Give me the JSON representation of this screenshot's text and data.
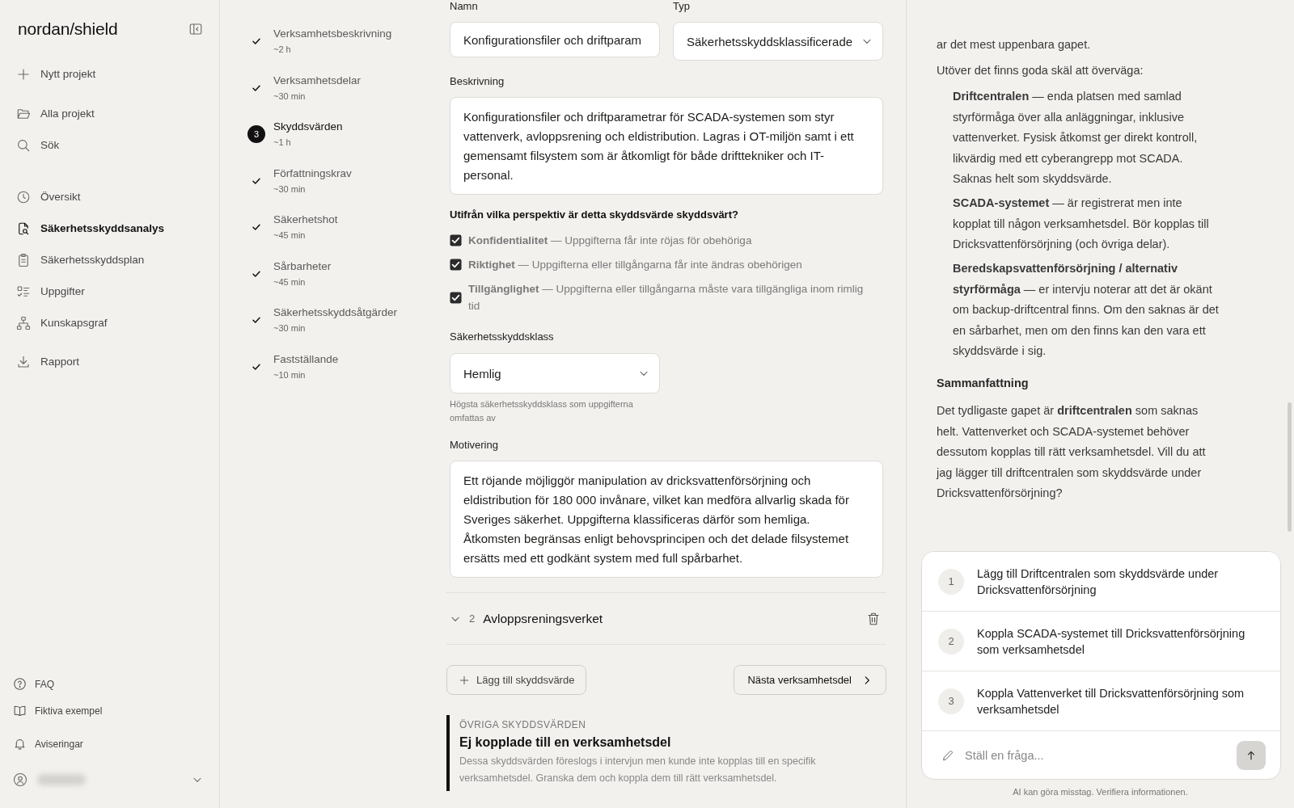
{
  "sidebar": {
    "logo": "nordan/shield",
    "groups": [
      {
        "items": [
          {
            "label": "Nytt projekt",
            "selected": false
          }
        ]
      },
      {
        "items": [
          {
            "label": "Alla projekt",
            "selected": false
          },
          {
            "label": "Sök",
            "selected": false
          }
        ]
      },
      {
        "items": [
          {
            "label": "Översikt",
            "selected": false
          },
          {
            "label": "Säkerhetsskyddsanalys",
            "selected": true
          },
          {
            "label": "Säkerhetsskyddsplan",
            "selected": false
          },
          {
            "label": "Uppgifter",
            "selected": false
          },
          {
            "label": "Kunskapsgraf",
            "selected": false
          }
        ]
      },
      {
        "items": [
          {
            "label": "Rapport",
            "selected": false
          }
        ]
      }
    ],
    "footer_items": [
      {
        "label": "FAQ"
      },
      {
        "label": "Fiktiva exempel"
      },
      {
        "label": "Aviseringar"
      }
    ]
  },
  "steps": [
    {
      "label": "Verksamhetsbeskrivning",
      "duration": "~2 h",
      "completed": true,
      "selected": false
    },
    {
      "label": "Verksamhetsdelar",
      "duration": "~30 min",
      "completed": true,
      "selected": false
    },
    {
      "label": "Skyddsvärden",
      "duration": "~1 h",
      "completed": false,
      "selected": true,
      "number": "3"
    },
    {
      "label": "Författningskrav",
      "duration": "~30 min",
      "completed": true,
      "selected": false
    },
    {
      "label": "Säkerhetshot",
      "duration": "~45 min",
      "completed": true,
      "selected": false
    },
    {
      "label": "Sårbarheter",
      "duration": "~45 min",
      "completed": true,
      "selected": false
    },
    {
      "label": "Säkerhetsskyddsåtgärder",
      "duration": "~30 min",
      "completed": true,
      "selected": false
    },
    {
      "label": "Fastställande",
      "duration": "~10 min",
      "completed": true,
      "selected": false
    }
  ],
  "protection_value": {
    "name_field": {
      "label": "Namn",
      "value": "Konfigurationsfiler och driftparam"
    },
    "type_field": {
      "label": "Typ",
      "value": "Säkerhetsskyddsklassificerade"
    },
    "description_field": {
      "label": "Beskrivning",
      "value": "Konfigurationsfiler och driftparametrar för SCADA-systemen som styr vattenverk, avloppsrening och eldistribution. Lagras i OT-miljön samt i ett gemensamt filsystem som är åtkomligt för både drifttekniker och IT-personal."
    },
    "perspectives": {
      "question": "Utifrån vilka perspektiv är detta skyddsvärde skyddsvärt?",
      "options": [
        {
          "label": "**Konfidentialitet** — Uppgifterna får inte röjas för obehöriga",
          "checked": true
        },
        {
          "label": "**Riktighet** — Uppgifterna eller tillgångarna får inte ändras obehörigen",
          "checked": true
        },
        {
          "label": "**Tillgänglighet** — Uppgifterna eller tillgångarna måste vara tillgängliga inom rimlig tid",
          "checked": true
        }
      ]
    },
    "classification_field": {
      "label": "Säkerhetsskyddsklass",
      "value": "Hemlig",
      "hint": "Högsta säkerhetsskyddsklass som uppgifterna omfattas av"
    },
    "motivation_field": {
      "label": "Motivering",
      "value": "Ett röjande möjliggör manipulation av dricksvattenförsörjning och eldistribution för 180 000 invånare, vilket kan medföra allvarlig skada för Sveriges säkerhet. Uppgifterna klassificeras därför som hemliga. Åtkomsten begränsas enligt behovsprincipen och det delade filsystemet ersätts med ett godkänt system med full spårbarhet."
    }
  },
  "collapsed_values": [
    {
      "number": "2",
      "title": "Avloppsreningsverket"
    }
  ],
  "add_button": "Lägg till skyddsvärde",
  "next_button": "Nästa verksamhetsdel",
  "unlinked_section": {
    "eyebrow": "ÖVRIGA SKYDDSVÄRDEN",
    "title": "Ej kopplade till en verksamhetsdel",
    "description": "Dessa skyddsvärden föreslogs i intervjun men kunde inte kopplas till en specifik verksamhetsdel. Granska dem och koppla dem till rätt verksamhetsdel."
  },
  "chat": {
    "blocks": [
      {
        "kind": "paragraph",
        "text": "ar det mest uppenbara gapet."
      },
      {
        "kind": "paragraph",
        "text": "Utöver det finns goda skäl att överväga:"
      },
      {
        "kind": "list_item",
        "text": "**Driftcentralen** — enda platsen med samlad styrförmåga över alla anläggningar, inklusive vattenverket. Fysisk åtkomst ger direkt kontroll, likvärdig med ett cyberangrepp mot SCADA. Saknas helt som skyddsvärde."
      },
      {
        "kind": "list_item",
        "text": "**SCADA-systemet** — är registrerat men inte kopplat till någon verksamhetsdel. Bör kopplas till Dricksvattenförsörjning (och övriga delar)."
      },
      {
        "kind": "list_item",
        "text": "**Beredskapsvattenförsörjning / alternativ styrförmåga** — er intervju noterar att det är okänt om backup-driftcentral finns. Om den saknas är det en sårbarhet, men om den finns kan den vara ett skyddsvärde i sig."
      },
      {
        "kind": "heading",
        "text": "Sammanfattning"
      },
      {
        "kind": "paragraph",
        "text": "Det tydligaste gapet är **driftcentralen** som saknas helt. Vattenverket och SCADA-systemet behöver dessutom kopplas till rätt verksamhetsdel. Vill du att jag lägger till driftcentralen som skyddsvärde under Dricksvattenförsörjning?"
      }
    ],
    "suggestions": [
      {
        "number": "1",
        "text": "Lägg till Driftcentralen som skyddsvärde under Dricksvattenförsörjning"
      },
      {
        "number": "2",
        "text": "Koppla SCADA-systemet till Dricksvattenförsörjning som verksamhetsdel"
      },
      {
        "number": "3",
        "text": "Koppla Vattenverket till Dricksvattenförsörjning som verksamhetsdel"
      }
    ],
    "input": {
      "placeholder": "Ställ en fråga..."
    },
    "disclaimer": "AI kan göra misstag. Verifiera informationen."
  }
}
